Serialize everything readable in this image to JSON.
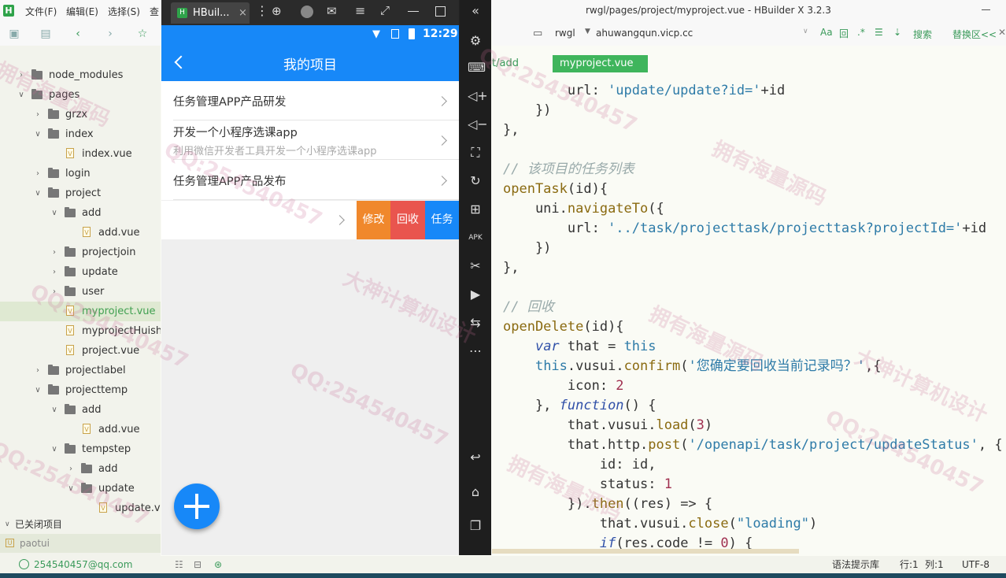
{
  "app": {
    "window_title": "rwgl/pages/project/myproject.vue - HBuilder X 3.2.3",
    "menu": [
      "文件(F)",
      "编辑(E)",
      "选择(S)",
      "查"
    ]
  },
  "file_tree": [
    {
      "label": "node_modules",
      "type": "folder",
      "depth": 1,
      "expanded": false
    },
    {
      "label": "pages",
      "type": "folder",
      "depth": 1,
      "expanded": true
    },
    {
      "label": "grzx",
      "type": "folder",
      "depth": 2,
      "expanded": false
    },
    {
      "label": "index",
      "type": "folder",
      "depth": 2,
      "expanded": true
    },
    {
      "label": "index.vue",
      "type": "file",
      "depth": 3
    },
    {
      "label": "login",
      "type": "folder",
      "depth": 2,
      "expanded": false
    },
    {
      "label": "project",
      "type": "folder",
      "depth": 2,
      "expanded": true
    },
    {
      "label": "add",
      "type": "folder",
      "depth": 3,
      "expanded": true
    },
    {
      "label": "add.vue",
      "type": "file",
      "depth": 4
    },
    {
      "label": "projectjoin",
      "type": "folder",
      "depth": 3,
      "expanded": false
    },
    {
      "label": "update",
      "type": "folder",
      "depth": 3,
      "expanded": false
    },
    {
      "label": "user",
      "type": "folder",
      "depth": 3,
      "expanded": false
    },
    {
      "label": "myproject.vue",
      "type": "file",
      "depth": 3,
      "selected": true
    },
    {
      "label": "myprojectHuishou",
      "type": "file",
      "depth": 3
    },
    {
      "label": "project.vue",
      "type": "file",
      "depth": 3
    },
    {
      "label": "projectlabel",
      "type": "folder",
      "depth": 2,
      "expanded": false
    },
    {
      "label": "projecttemp",
      "type": "folder",
      "depth": 2,
      "expanded": true
    },
    {
      "label": "add",
      "type": "folder",
      "depth": 3,
      "expanded": true
    },
    {
      "label": "add.vue",
      "type": "file",
      "depth": 4
    },
    {
      "label": "tempstep",
      "type": "folder",
      "depth": 3,
      "expanded": true
    },
    {
      "label": "add",
      "type": "folder",
      "depth": 4,
      "expanded": false
    },
    {
      "label": "update",
      "type": "folder",
      "depth": 4,
      "expanded": true
    },
    {
      "label": "update.vue",
      "type": "file",
      "depth": 5
    }
  ],
  "sidebar": {
    "closed_projects_label": "已关闭项目",
    "closed_project": "paotui"
  },
  "phone": {
    "tab_label": "HBuil...",
    "time": "12:29",
    "nav_title": "我的项目",
    "items": [
      {
        "title": "任务管理APP产品研发",
        "note": ""
      },
      {
        "title": "开发一个小程序选课app",
        "note": "利用微信开发者工具开发一个小程序选课app"
      },
      {
        "title": "任务管理APP产品发布",
        "note": ""
      }
    ],
    "swipe_buttons": [
      {
        "label": "修改",
        "color": "#f0882c"
      },
      {
        "label": "回收",
        "color": "#e9554e"
      },
      {
        "label": "任务",
        "color": "#1788f8"
      }
    ]
  },
  "editor": {
    "project": "rwgl",
    "host": "ahuwangqun.vicp.cc",
    "search_label": "搜索",
    "replace_label": "替换区<<",
    "prev_tab": "t/add",
    "active_tab": "myproject.vue"
  },
  "statusbar": {
    "account": "254540457@qq.com",
    "syntax_lib": "语法提示库",
    "row": "行:1",
    "col": "列:1",
    "encoding": "UTF-8"
  },
  "watermark": [
    "拥有海量源码",
    "QQ:254540457",
    "大神计算机设计"
  ],
  "colors": {
    "brand_blue": "#1788f8",
    "ide_green": "#2fa34a"
  }
}
